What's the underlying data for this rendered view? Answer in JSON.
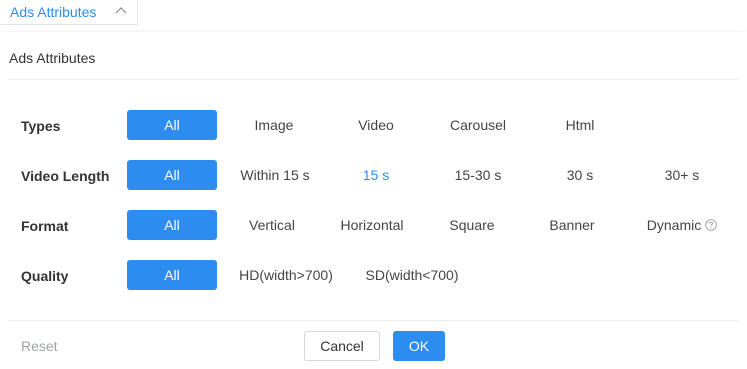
{
  "trigger": {
    "label": "Ads Attributes",
    "icon": "chevron-up-icon"
  },
  "panel": {
    "title": "Ads Attributes"
  },
  "rows": [
    {
      "label": "Types",
      "options": [
        "All",
        "Image",
        "Video",
        "Carousel",
        "Html"
      ],
      "selected": "All"
    },
    {
      "label": "Video Length",
      "options": [
        "All",
        "Within 15 s",
        "15 s",
        "15-30 s",
        "30 s",
        "30+ s"
      ],
      "selected": "All",
      "highlighted": "15 s"
    },
    {
      "label": "Format",
      "options": [
        "All",
        "Vertical",
        "Horizontal",
        "Square",
        "Banner",
        "Dynamic"
      ],
      "selected": "All",
      "help_icon_on": "Dynamic"
    },
    {
      "label": "Quality",
      "options": [
        "All",
        "HD(width>700)",
        "SD(width<700)"
      ],
      "selected": "All"
    }
  ],
  "footer": {
    "reset_label": "Reset",
    "cancel_label": "Cancel",
    "ok_label": "OK"
  },
  "colors": {
    "accent": "#2d8cf0",
    "muted": "#9ea3a8",
    "divider": "#ececec"
  }
}
